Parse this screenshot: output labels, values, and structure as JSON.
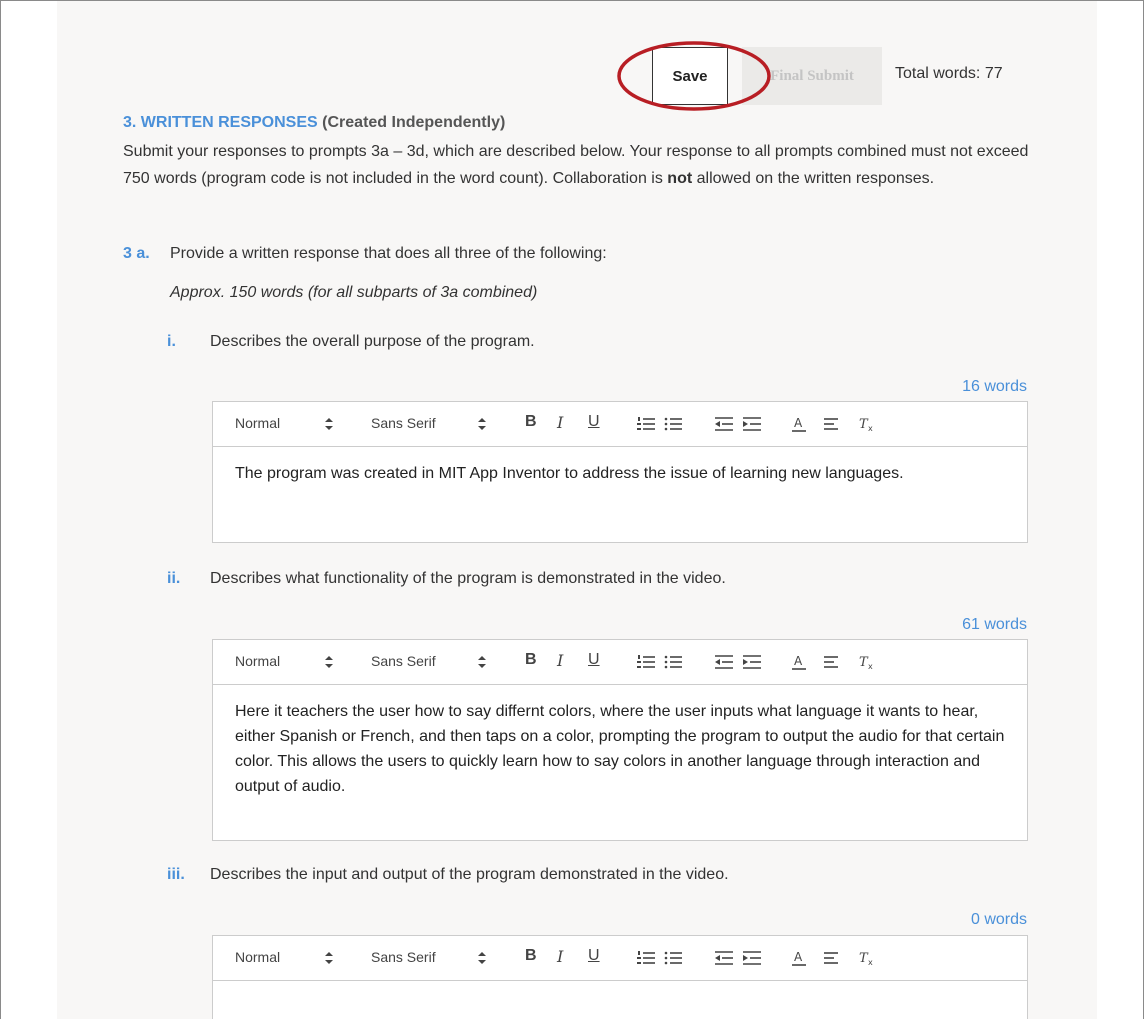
{
  "toolbar": {
    "save_label": "Save",
    "final_submit_label": "Final Submit",
    "total_words": "Total words: 77"
  },
  "section": {
    "title": "3. WRITTEN RESPONSES",
    "subtitle": "(Created Independently)",
    "intro_before_bold": "Submit your responses to prompts 3a – 3d, which are described below. Your response to all prompts combined must not exceed 750 words (program code is not included in the word count). Collaboration is",
    "intro_bold": "not",
    "intro_after_bold": "allowed on the written responses."
  },
  "question": {
    "label": "3 a.",
    "text": "Provide a written response that does all three of the following:",
    "note": "Approx. 150 words (for all subparts of 3a combined)"
  },
  "editor_toolbar": {
    "format_label": "Normal",
    "font_label": "Sans Serif",
    "bold": "B",
    "italic": "I",
    "underline": "U"
  },
  "subparts": [
    {
      "numeral": "i.",
      "prompt": "Describes the overall purpose of the program.",
      "word_count": "16 words",
      "response": "The program was created in MIT App Inventor to address the issue of learning new languages."
    },
    {
      "numeral": "ii.",
      "prompt": "Describes what functionality of the program is demonstrated in the video.",
      "word_count": "61 words",
      "response": "Here it teachers the user how to say differnt colors, where the user inputs what language it wants to hear, either Spanish or French, and then taps on a color, prompting the program to output the audio for that certain color.  This allows the users to quickly learn how to say colors in another language through interaction and output of audio."
    },
    {
      "numeral": "iii.",
      "prompt": "Describes the input and output of the program demonstrated in the video.",
      "word_count": "0 words",
      "response": ""
    }
  ],
  "colors": {
    "accent": "#4a90d9",
    "annotation": "#b81e24",
    "page_bg": "#f8f7f6"
  }
}
